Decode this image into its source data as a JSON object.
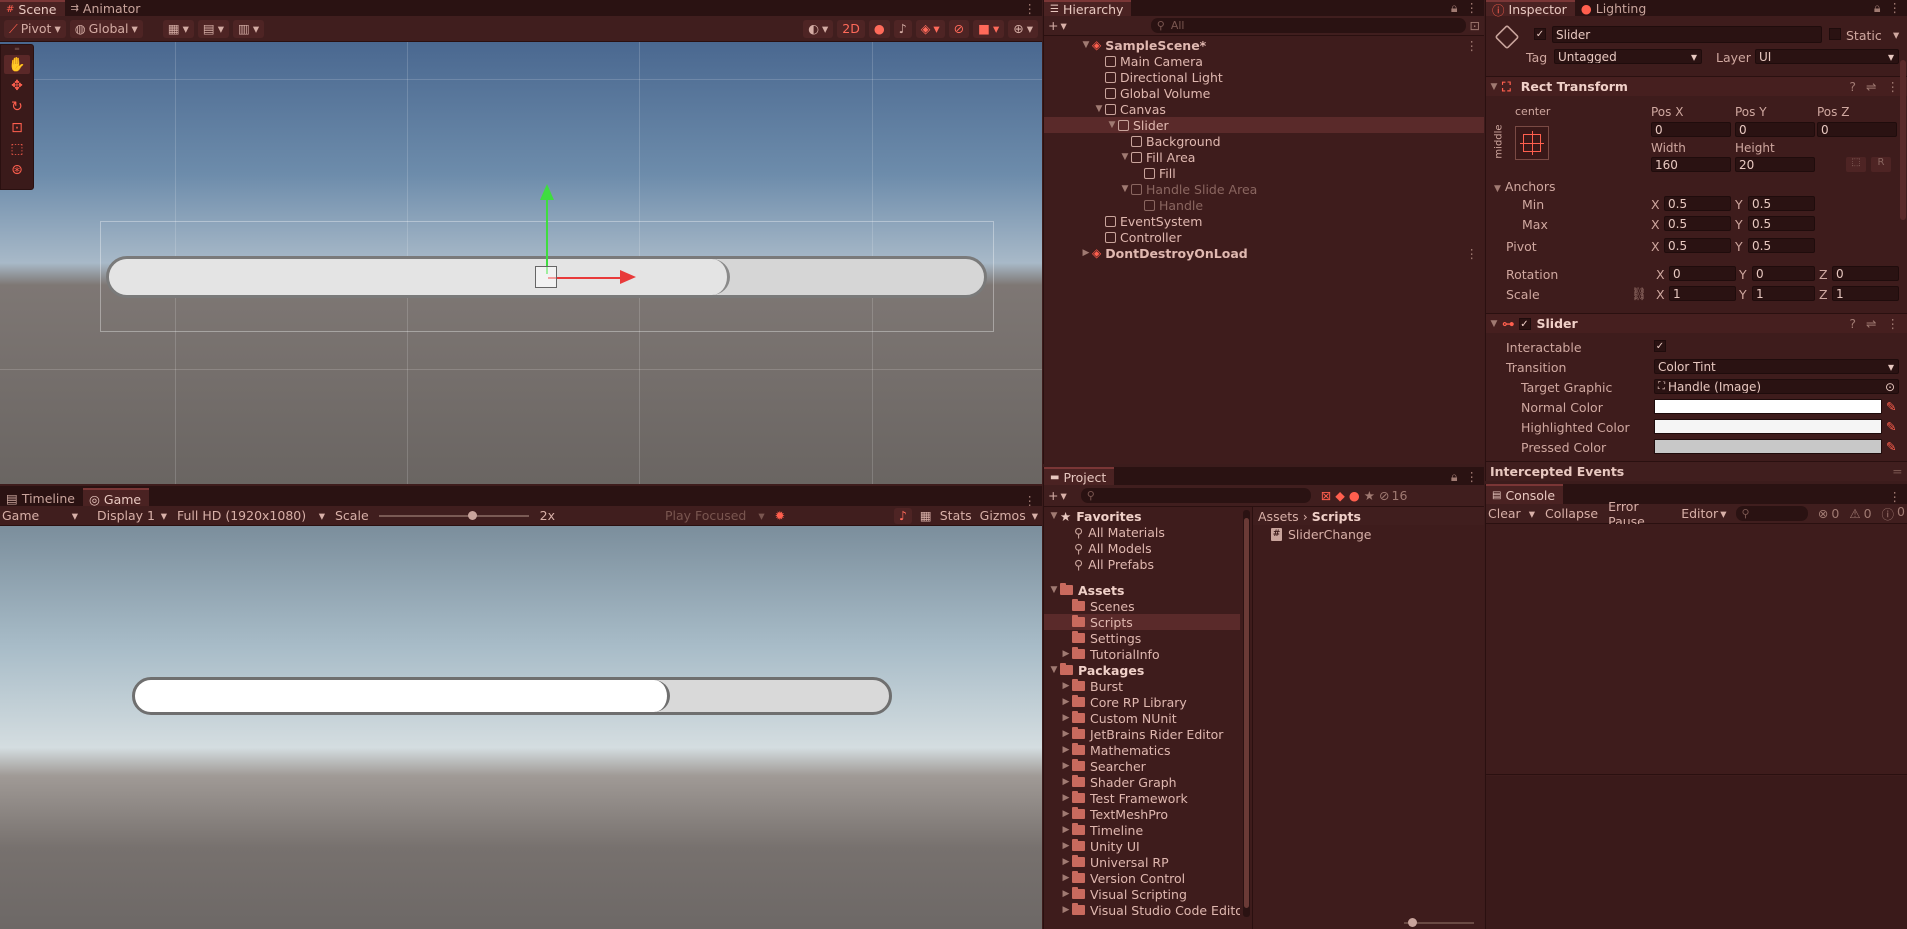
{
  "scene_panel": {
    "tabs": [
      "Scene",
      "Animator"
    ],
    "toolbar": {
      "pivot": "Pivot",
      "global": "Global",
      "mode_2d": "2D"
    }
  },
  "game_panel": {
    "tabs": [
      "Timeline",
      "Game"
    ],
    "toolbar": {
      "view": "Game",
      "display": "Display 1",
      "resolution": "Full HD (1920x1080)",
      "scale_label": "Scale",
      "scale_value": "2x",
      "play_focused": "Play Focused",
      "stats": "Stats",
      "gizmos": "Gizmos"
    },
    "slider_fill": 0.71
  },
  "scene_slider_fill": 0.71,
  "hierarchy": {
    "tab": "Hierarchy",
    "search_placeholder": "All",
    "items": [
      {
        "label": "SampleScene*",
        "depth": 0,
        "arrow": "▼",
        "kind": "scene"
      },
      {
        "label": "Main Camera",
        "depth": 1,
        "arrow": "",
        "kind": "go"
      },
      {
        "label": "Directional Light",
        "depth": 1,
        "arrow": "",
        "kind": "go"
      },
      {
        "label": "Global Volume",
        "depth": 1,
        "arrow": "",
        "kind": "go"
      },
      {
        "label": "Canvas",
        "depth": 1,
        "arrow": "▼",
        "kind": "go"
      },
      {
        "label": "Slider",
        "depth": 2,
        "arrow": "▼",
        "kind": "go",
        "selected": true
      },
      {
        "label": "Background",
        "depth": 3,
        "arrow": "",
        "kind": "go"
      },
      {
        "label": "Fill Area",
        "depth": 3,
        "arrow": "▼",
        "kind": "go"
      },
      {
        "label": "Fill",
        "depth": 4,
        "arrow": "",
        "kind": "go"
      },
      {
        "label": "Handle Slide Area",
        "depth": 3,
        "arrow": "▼",
        "kind": "go",
        "dim": true
      },
      {
        "label": "Handle",
        "depth": 4,
        "arrow": "",
        "kind": "go",
        "dim": true
      },
      {
        "label": "EventSystem",
        "depth": 1,
        "arrow": "",
        "kind": "go"
      },
      {
        "label": "Controller",
        "depth": 1,
        "arrow": "",
        "kind": "go"
      },
      {
        "label": "DontDestroyOnLoad",
        "depth": 0,
        "arrow": "▶",
        "kind": "scene"
      }
    ]
  },
  "inspector": {
    "tabs": [
      "Inspector",
      "Lighting"
    ],
    "object_name": "Slider",
    "static_label": "Static",
    "tag_label": "Tag",
    "tag_value": "Untagged",
    "layer_label": "Layer",
    "layer_value": "UI",
    "rect_transform": {
      "title": "Rect Transform",
      "anchor_preset_top": "center",
      "anchor_preset_side": "middle",
      "pos_x_label": "Pos X",
      "pos_y_label": "Pos Y",
      "pos_z_label": "Pos Z",
      "pos_x": "0",
      "pos_y": "0",
      "pos_z": "0",
      "width_label": "Width",
      "height_label": "Height",
      "width": "160",
      "height": "20",
      "r_button": "R",
      "anchors_label": "Anchors",
      "min_label": "Min",
      "max_label": "Max",
      "min_x": "0.5",
      "min_y": "0.5",
      "max_x": "0.5",
      "max_y": "0.5",
      "pivot_label": "Pivot",
      "pivot_x": "0.5",
      "pivot_y": "0.5",
      "rotation_label": "Rotation",
      "rot_x": "0",
      "rot_y": "0",
      "rot_z": "0",
      "scale_label": "Scale",
      "scale_x": "1",
      "scale_y": "1",
      "scale_z": "1",
      "axis_x": "X",
      "axis_y": "Y",
      "axis_z": "Z"
    },
    "slider": {
      "title": "Slider",
      "interactable_label": "Interactable",
      "transition_label": "Transition",
      "transition_value": "Color Tint",
      "target_graphic_label": "Target Graphic",
      "target_graphic_value": "Handle (Image)",
      "normal_color_label": "Normal Color",
      "highlighted_color_label": "Highlighted Color",
      "pressed_color_label": "Pressed Color",
      "normal_color": "#ffffff",
      "highlighted_color": "#f5f5f5",
      "pressed_color": "#c8c8c8"
    },
    "intercepted_events": "Intercepted Events"
  },
  "project": {
    "tab": "Project",
    "hidden_count": "16",
    "favorites_label": "Favorites",
    "favorites": [
      "All Materials",
      "All Models",
      "All Prefabs"
    ],
    "assets_label": "Assets",
    "asset_folders": [
      "Scenes",
      "Scripts",
      "Settings",
      "TutorialInfo"
    ],
    "selected_folder": "Scripts",
    "packages_label": "Packages",
    "packages": [
      "Burst",
      "Core RP Library",
      "Custom NUnit",
      "JetBrains Rider Editor",
      "Mathematics",
      "Searcher",
      "Shader Graph",
      "Test Framework",
      "TextMeshPro",
      "Timeline",
      "Unity UI",
      "Universal RP",
      "Version Control",
      "Visual Scripting",
      "Visual Studio Code Editor"
    ],
    "breadcrumb_root": "Assets",
    "breadcrumb_leaf": "Scripts",
    "files": [
      "SliderChange"
    ]
  },
  "console": {
    "tab": "Console",
    "clear": "Clear",
    "collapse": "Collapse",
    "error_pause": "Error Pause",
    "editor": "Editor",
    "error_count": "0",
    "warning_count": "0",
    "log_count": "0"
  },
  "colors": {
    "accent": "#ff5f4e",
    "panel_bg": "#3e1c1c",
    "selected_row": "#5a2a2a"
  }
}
